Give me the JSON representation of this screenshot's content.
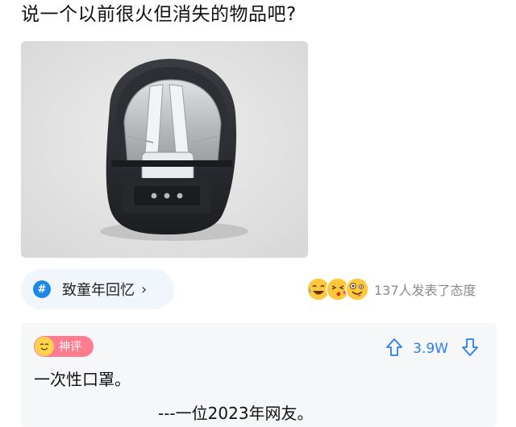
{
  "question": {
    "title": "说一个以前很火但消失的物品吧?"
  },
  "topic_tag": {
    "icon": "hash-icon",
    "hash_symbol": "#",
    "label": "致童年回忆",
    "arrow": "›",
    "accent": "#1e88e5"
  },
  "reactions": {
    "emojis": [
      "laughing-crying-icon",
      "kissing-face-icon",
      "crazy-face-icon"
    ],
    "summary": "137人发表了态度"
  },
  "comment": {
    "badge": {
      "icon": "smiling-face-icon",
      "label": "神评",
      "color": "#ff7b8e"
    },
    "vote_count": "3.9W",
    "text": "一次性口罩。",
    "signature": "---一位2023年网友。",
    "accent": "#2b7de9"
  }
}
